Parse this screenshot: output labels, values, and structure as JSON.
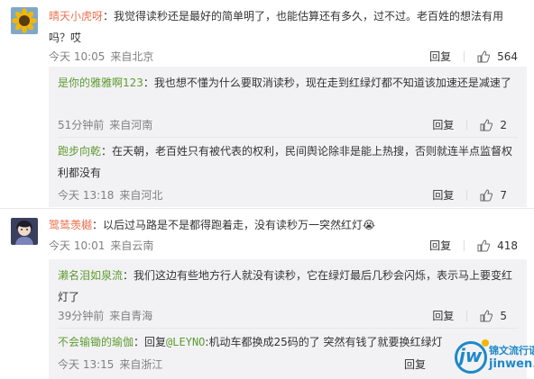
{
  "comments": [
    {
      "username": "晴天小虎呀",
      "text": "我觉得读秒还是最好的简单明了，也能估算还有多久，过不过。老百姓的想法有用吗？哎",
      "time": "今天 10:05",
      "location": "来自北京",
      "reply_label": "回复",
      "likes": "564",
      "replies": [
        {
          "username": "是你的雅雅啊123",
          "text": "我也想不懂为什么要取消读秒，现在走到红绿灯都不知道该加速还是减速了",
          "time": "51分钟前",
          "location": "来自河南",
          "reply_label": "回复",
          "likes": "2"
        },
        {
          "username": "跑步向乾",
          "text": "在天朝，老百姓只有被代表的权利，民间舆论除非是能上热搜，否则就连半点监督权利都没有",
          "time": "今天 13:18",
          "location": "来自河北",
          "reply_label": "回复",
          "likes": "7"
        }
      ]
    },
    {
      "username": "鹭鸶羡樾",
      "text": "以后过马路是不是都得跑着走，没有读秒万一突然红灯",
      "emoji": "😭",
      "time": "今天 10:01",
      "location": "来自云南",
      "reply_label": "回复",
      "likes": "418",
      "replies": [
        {
          "username": "濑名泪如泉流",
          "text": "我们这边有些地方行人就没有读秒，它在绿灯最后几秒会闪烁，表示马上要变红灯了",
          "time": "39分钟前",
          "location": "来自青海",
          "reply_label": "回复",
          "likes": "5"
        },
        {
          "username": "不会输锄的瑜伽",
          "reply_prefix": "回复",
          "mention": "@LEYNO",
          "text": "机动车都换成25码的了 突然有钱了就要换红绿灯",
          "time": "今天 13:15",
          "location": "来自浙江",
          "reply_label": "回复",
          "likes": ""
        }
      ]
    }
  ],
  "watermark": {
    "logo": "jw",
    "cn": "锦文流行语",
    "en": "jinwen.net"
  },
  "colors": {
    "username": "#eb7350",
    "subusername": "#5f9b2f",
    "subbg": "#f2f2f5",
    "meta": "#808080",
    "accent": "#1e88c8"
  },
  "icons": [
    "thumbs-up-icon",
    "sunflower-avatar",
    "girl-avatar",
    "crying-face-emoji"
  ]
}
